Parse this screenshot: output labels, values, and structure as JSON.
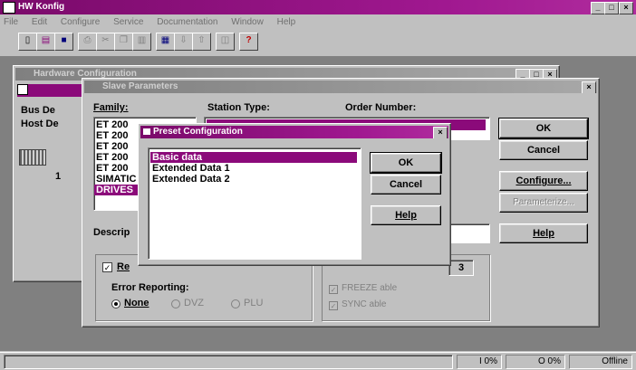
{
  "app": {
    "title": "HW Konfig",
    "menu": [
      "File",
      "Edit",
      "Configure",
      "Service",
      "Documentation",
      "Window",
      "Help"
    ]
  },
  "mdi_window": {
    "title": "Hardware Configuration"
  },
  "left_panel": {
    "bus_label": "Bus De",
    "host_label": "Host De",
    "slot": "1"
  },
  "slave_dialog": {
    "title": "Slave Parameters",
    "family_label": "Family:",
    "station_type_label": "Station Type:",
    "order_number_label": "Order Number:",
    "family_items": [
      "ET 200",
      "ET 200",
      "ET 200",
      "ET 200",
      "ET 200",
      "SIMATIC",
      "DRIVES"
    ],
    "description_label": "Descrip",
    "checkbox_label": "Re",
    "error_reporting_label": "Error Reporting:",
    "radio_none": "None",
    "radio_2": "DVZ",
    "radio_3": "PLU",
    "address_value": "3",
    "check_1": "FREEZE able",
    "check_2": "SYNC able",
    "buttons": {
      "ok": "OK",
      "cancel": "Cancel",
      "configure": "Configure...",
      "parameterize": "Parameterize...",
      "help": "Help"
    }
  },
  "preset_dialog": {
    "title": "Preset Configuration",
    "items": [
      "Basic data",
      "Extended Data 1",
      "Extended Data 2"
    ],
    "selected_index": 0,
    "buttons": {
      "ok": "OK",
      "cancel": "Cancel",
      "help": "Help"
    }
  },
  "statusbar": {
    "cell1": "I 0%",
    "cell2": "O 0%",
    "cell3": "Offline"
  },
  "colors": {
    "accent": "#8b0a7a",
    "face": "#c0c0c0",
    "desktop": "#808080"
  }
}
